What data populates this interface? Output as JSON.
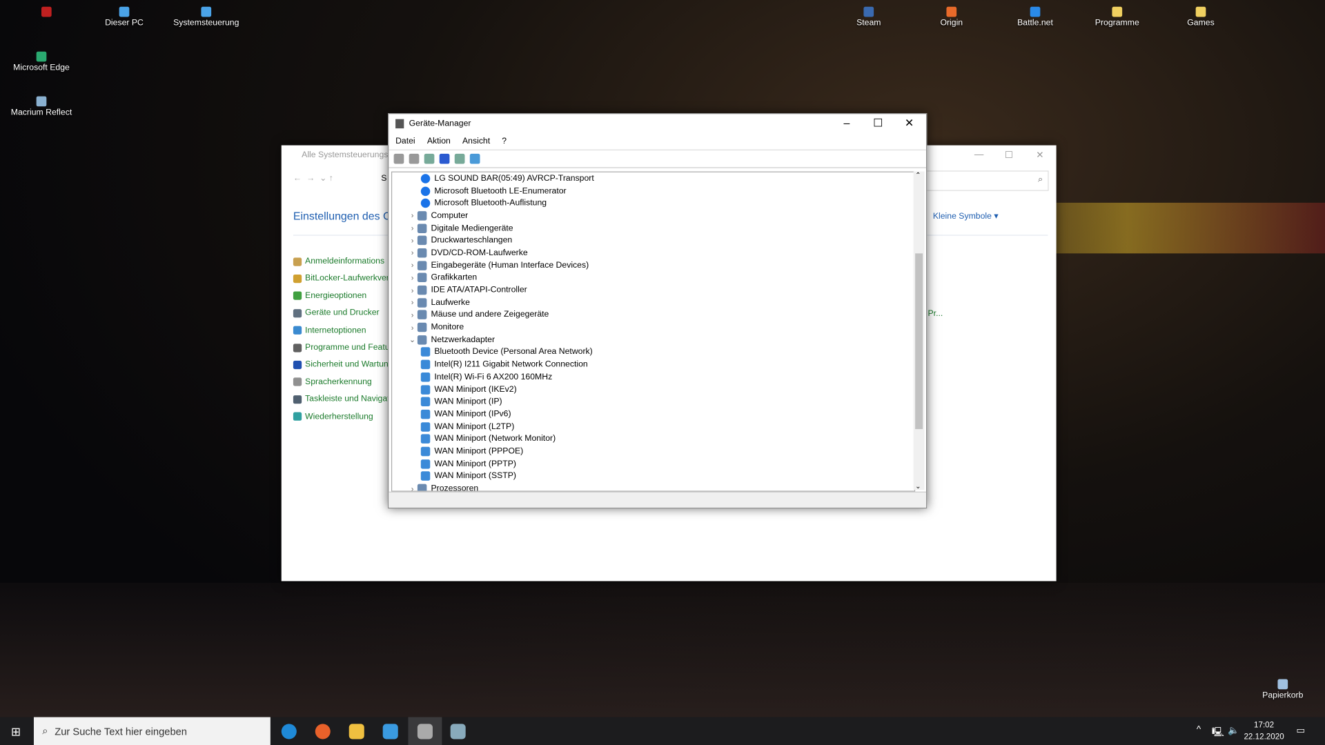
{
  "desktop": {
    "icons": [
      {
        "label": "",
        "color": "#c02020"
      },
      {
        "label": "Dieser PC",
        "color": "#4aa3e8"
      },
      {
        "label": "Systemsteuerung",
        "color": "#4aa3e8"
      },
      {
        "label": "Microsoft Edge",
        "color": "#2aa970"
      },
      {
        "label": "Macrium Reflect",
        "color": "#8ab0d0"
      },
      {
        "label": "Steam",
        "color": "#3a6ab0"
      },
      {
        "label": "Origin",
        "color": "#e86a2a"
      },
      {
        "label": "Battle.net",
        "color": "#2a8ae8"
      },
      {
        "label": "Programme",
        "color": "#f0d060"
      },
      {
        "label": "Games",
        "color": "#f0d060"
      },
      {
        "label": "Papierkorb",
        "color": "#a0c0e0"
      }
    ]
  },
  "control_panel": {
    "title": "Alle Systemsteuerungselemente",
    "breadcrumb": "S",
    "heading": "Einstellungen des C",
    "view_label": "Kleine Symbole",
    "partial_link": "Pr...",
    "links": [
      {
        "label": "Anmeldeinformations",
        "color": "#c8a050"
      },
      {
        "label": "BitLocker-Laufwerkver",
        "color": "#d0a030"
      },
      {
        "label": "Energieoptionen",
        "color": "#40a040"
      },
      {
        "label": "Geräte und Drucker",
        "color": "#607080"
      },
      {
        "label": "Internetoptionen",
        "color": "#3a8ad0"
      },
      {
        "label": "Programme und Featu",
        "color": "#606060"
      },
      {
        "label": "Sicherheit und Wartun",
        "color": "#2050b0"
      },
      {
        "label": "Spracherkennung",
        "color": "#909090"
      },
      {
        "label": "Taskleiste und Navigat",
        "color": "#506070"
      },
      {
        "label": "Wiederherstellung",
        "color": "#30a0a0"
      }
    ]
  },
  "device_manager": {
    "title": "Geräte-Manager",
    "menu": [
      "Datei",
      "Aktion",
      "Ansicht",
      "?"
    ],
    "tree": [
      {
        "label": "LG SOUND BAR(05:49) AVRCP-Transport",
        "level": 2,
        "icon": "bluetooth"
      },
      {
        "label": "Microsoft Bluetooth LE-Enumerator",
        "level": 2,
        "icon": "bluetooth"
      },
      {
        "label": "Microsoft Bluetooth-Auflistung",
        "level": 2,
        "icon": "bluetooth"
      },
      {
        "label": "Computer",
        "level": 1,
        "state": "collapsed"
      },
      {
        "label": "Digitale Mediengeräte",
        "level": 1,
        "state": "collapsed"
      },
      {
        "label": "Druckwarteschlangen",
        "level": 1,
        "state": "collapsed"
      },
      {
        "label": "DVD/CD-ROM-Laufwerke",
        "level": 1,
        "state": "collapsed"
      },
      {
        "label": "Eingabegeräte (Human Interface Devices)",
        "level": 1,
        "state": "collapsed"
      },
      {
        "label": "Grafikkarten",
        "level": 1,
        "state": "collapsed"
      },
      {
        "label": "IDE ATA/ATAPI-Controller",
        "level": 1,
        "state": "collapsed"
      },
      {
        "label": "Laufwerke",
        "level": 1,
        "state": "collapsed"
      },
      {
        "label": "Mäuse und andere Zeigegeräte",
        "level": 1,
        "state": "collapsed"
      },
      {
        "label": "Monitore",
        "level": 1,
        "state": "collapsed"
      },
      {
        "label": "Netzwerkadapter",
        "level": 1,
        "state": "expanded"
      },
      {
        "label": "Bluetooth Device (Personal Area Network)",
        "level": 2,
        "icon": "network"
      },
      {
        "label": "Intel(R) I211 Gigabit Network Connection",
        "level": 2,
        "icon": "network"
      },
      {
        "label": "Intel(R) Wi-Fi 6 AX200 160MHz",
        "level": 2,
        "icon": "network"
      },
      {
        "label": "WAN Miniport (IKEv2)",
        "level": 2,
        "icon": "network"
      },
      {
        "label": "WAN Miniport (IP)",
        "level": 2,
        "icon": "network"
      },
      {
        "label": "WAN Miniport (IPv6)",
        "level": 2,
        "icon": "network"
      },
      {
        "label": "WAN Miniport (L2TP)",
        "level": 2,
        "icon": "network"
      },
      {
        "label": "WAN Miniport (Network Monitor)",
        "level": 2,
        "icon": "network"
      },
      {
        "label": "WAN Miniport (PPPOE)",
        "level": 2,
        "icon": "network"
      },
      {
        "label": "WAN Miniport (PPTP)",
        "level": 2,
        "icon": "network"
      },
      {
        "label": "WAN Miniport (SSTP)",
        "level": 2,
        "icon": "network"
      },
      {
        "label": "Prozessoren",
        "level": 1,
        "state": "collapsed"
      }
    ]
  },
  "taskbar": {
    "search_placeholder": "Zur Suche Text hier eingeben",
    "time": "17:02",
    "date": "22.12.2020"
  }
}
